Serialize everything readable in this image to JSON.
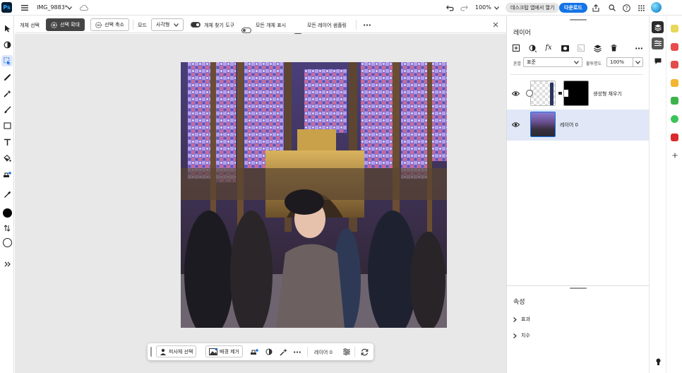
{
  "topbar": {
    "app_logo": "Ps",
    "doc_title": "IMG_9883*",
    "zoom": "100%",
    "open_desktop": "데스크탑 앱에서 열기",
    "download": "다운로드"
  },
  "options": {
    "tool_name": "개체 선택",
    "expand": "선택 확대",
    "contract": "선택 축소",
    "mode_label": "모드",
    "mode_value": "사각형",
    "object_finder": "개체 찾기 도구",
    "show_all": "모든 개체 표시",
    "sample_all": "모든 레이어 샘플링"
  },
  "context_bar": {
    "select_subject": "피사체 선택",
    "remove_bg": "배경 제거",
    "layer": "레이어 0"
  },
  "layers_panel": {
    "title": "레이어",
    "blend_label": "혼합",
    "blend_value": "표준",
    "opacity_label": "불투명도",
    "opacity_value": "100%",
    "layers": [
      {
        "name": "생성형 채우기",
        "visible": true
      },
      {
        "name": "레이어 0",
        "visible": true,
        "selected": true
      }
    ]
  },
  "properties_panel": {
    "title": "속성",
    "sections": [
      "효과",
      "치수"
    ]
  },
  "colors": {
    "accent": "#1473e6",
    "selection": "#e1e7f6",
    "ps_bg": "#001e36",
    "ps_fg": "#31a8ff"
  },
  "icons": [
    "menu-icon",
    "cloud-icon",
    "undo-icon",
    "redo-icon",
    "share-icon",
    "search-icon",
    "help-icon",
    "apps-icon",
    "avatar"
  ]
}
